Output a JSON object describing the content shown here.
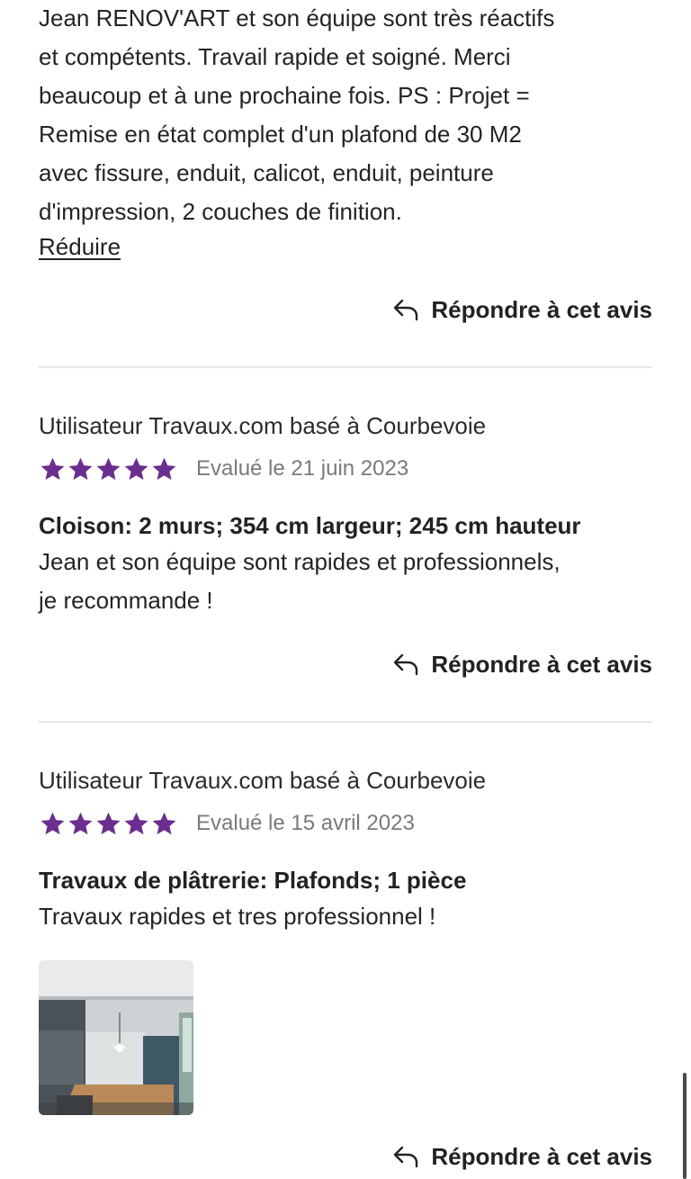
{
  "review_top": {
    "body_lines": [
      "Jean RENOV'ART et son équipe sont très réactifs",
      "et compétents. Travail rapide et soigné. Merci",
      "beaucoup et à une prochaine fois. PS : Projet =",
      "Remise en état complet d'un plafond de 30 M2",
      "avec fissure, enduit, calicot, enduit, peinture",
      "d'impression, 2 couches de finition."
    ],
    "collapse_label": "Réduire",
    "reply_label": "Répondre à cet avis"
  },
  "review_1": {
    "author": "Utilisateur Travaux.com basé à Courbevoie",
    "rating": 5,
    "date": "Evalué le 21 juin 2023",
    "title": "Cloison: 2 murs; 354 cm largeur; 245 cm hauteur",
    "body_lines": [
      "Jean et son équipe sont rapides et professionnels,",
      "je recommande !"
    ],
    "reply_label": "Répondre à cet avis"
  },
  "review_2": {
    "author": "Utilisateur Travaux.com basé à Courbevoie",
    "rating": 5,
    "date": "Evalué le 15 avril 2023",
    "title": "Travaux de plâtrerie: Plafonds; 1 pièce",
    "body": "Travaux rapides et tres professionnel !",
    "reply_label": "Répondre à cet avis"
  },
  "icons": {
    "star": "star-icon",
    "reply": "reply-arrow-icon"
  },
  "colors": {
    "star": "#6b2d8f",
    "text": "#222222",
    "muted": "#7a7a7a",
    "divider": "#e6e6e6"
  }
}
